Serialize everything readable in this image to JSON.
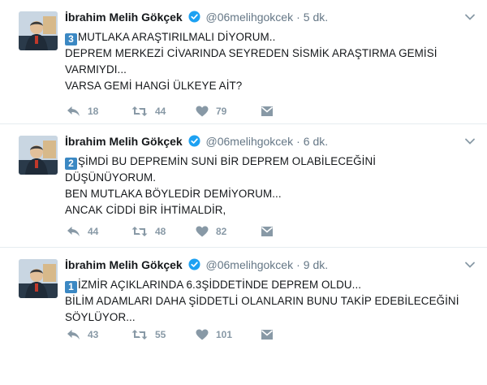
{
  "tweets": [
    {
      "author_name": "İbrahim Melih Gökçek",
      "handle": "@06melihgokcek",
      "separator": "·",
      "time": "5 dk.",
      "number_badge": "3",
      "lines": [
        "MUTLAKA ARAŞTIRILMALI DİYORUM..",
        "DEPREM MERKEZİ CİVARINDA SEYREDEN SİSMİK ARAŞTIRMA GEMİSİ",
        "VARMIYDI...",
        "VARSA GEMİ HANGİ ÜLKEYE AİT?"
      ],
      "replies": "18",
      "retweets": "44",
      "likes": "79"
    },
    {
      "author_name": "İbrahim Melih Gökçek",
      "handle": "@06melihgokcek",
      "separator": "·",
      "time": "6 dk.",
      "number_badge": "2",
      "lines": [
        "ŞİMDİ BU DEPREMİN SUNİ BİR DEPREM OLABİLECEĞİNİ",
        "DÜŞÜNÜYORUM.",
        "BEN MUTLAKA BÖYLEDİR DEMİYORUM...",
        "ANCAK CİDDİ BİR İHTİMALDİR,"
      ],
      "replies": "44",
      "retweets": "48",
      "likes": "82"
    },
    {
      "author_name": "İbrahim Melih Gökçek",
      "handle": "@06melihgokcek",
      "separator": "·",
      "time": "9 dk.",
      "number_badge": "1",
      "lines": [
        "İZMİR AÇIKLARINDA 6.3ŞİDDETİNDE DEPREM OLDU...",
        "BİLİM ADAMLARI DAHA ŞİDDETLİ OLANLARIN BUNU TAKİP EDEBİLECEĞİNİ",
        "SÖYLÜYOR..."
      ],
      "replies": "43",
      "retweets": "55",
      "likes": "101"
    }
  ],
  "icons": {
    "verified": "verified-badge-icon",
    "caret": "chevron-down-icon",
    "reply": "reply-icon",
    "retweet": "retweet-icon",
    "like": "heart-icon",
    "message": "direct-message-icon"
  },
  "colors": {
    "verified": "#1da1f2",
    "action_gray": "#8899a6",
    "number_badge": "#3b88c3",
    "text": "#14171a",
    "secondary": "#657786"
  }
}
